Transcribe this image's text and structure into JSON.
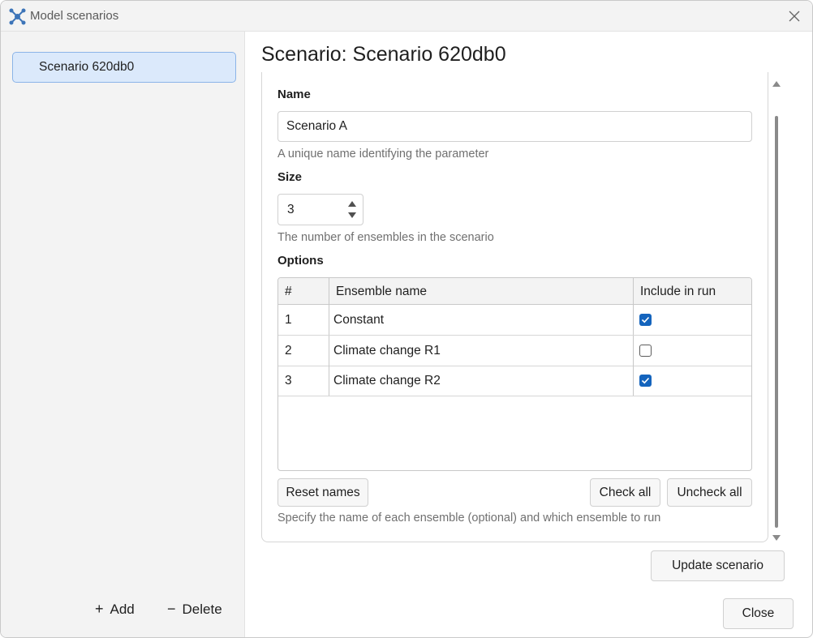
{
  "window": {
    "title": "Model scenarios",
    "app_icon": "network-nodes-icon",
    "close_icon": "close-icon"
  },
  "sidebar": {
    "items": [
      {
        "label": "Scenario 620db0"
      }
    ],
    "add_label": "Add",
    "add_symbol": "+",
    "delete_label": "Delete",
    "delete_symbol": "−"
  },
  "main": {
    "title": "Scenario: Scenario 620db0",
    "name": {
      "label": "Name",
      "value": "Scenario A",
      "helper": "A unique name identifying the parameter"
    },
    "size": {
      "label": "Size",
      "value": "3",
      "helper": "The number of ensembles in the scenario"
    },
    "options": {
      "label": "Options",
      "columns": [
        "#",
        "Ensemble name",
        "Include in run"
      ],
      "rows": [
        {
          "index": "1",
          "name": "Constant",
          "include": true
        },
        {
          "index": "2",
          "name": "Climate change R1",
          "include": false
        },
        {
          "index": "3",
          "name": "Climate change R2",
          "include": true
        }
      ],
      "reset_label": "Reset names",
      "check_all_label": "Check all",
      "uncheck_all_label": "Uncheck all",
      "helper": "Specify the name of each ensemble (optional) and which ensemble to run"
    },
    "update_label": "Update scenario",
    "close_label": "Close"
  },
  "colors": {
    "accent": "#1464bd",
    "selection_bg": "#dbe9fb",
    "selection_border": "#8bb4e8",
    "sidebar_bg": "#f3f3f3"
  }
}
